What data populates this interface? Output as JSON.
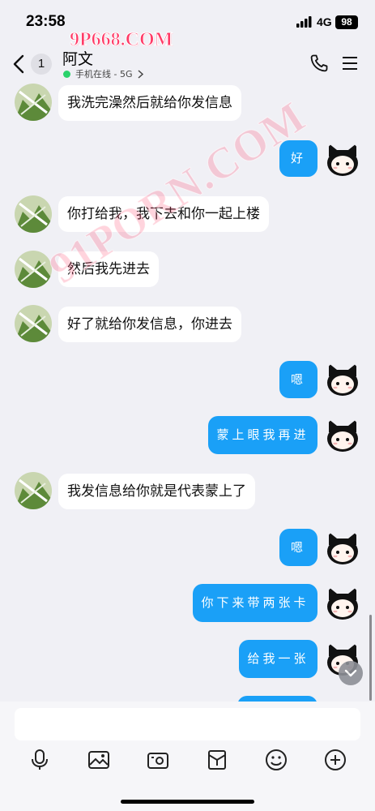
{
  "status_bar": {
    "time": "23:58",
    "network": "4G",
    "battery": "98"
  },
  "watermark": {
    "top": "9P668.COM",
    "diagonal": "91PORN.COM"
  },
  "header": {
    "unread_count": "1",
    "contact_name": "阿文",
    "online_status": "手机在线 - 5G"
  },
  "messages": [
    {
      "dir": "in",
      "text": "我洗完澡然后就给你发信息"
    },
    {
      "dir": "out",
      "text": "好"
    },
    {
      "dir": "in",
      "text": "你打给我，我下去和你一起上楼"
    },
    {
      "dir": "in",
      "text": "然后我先进去"
    },
    {
      "dir": "in",
      "text": "好了就给你发信息，你进去"
    },
    {
      "dir": "out",
      "text": "嗯"
    },
    {
      "dir": "out",
      "text": "蒙上眼我再进"
    },
    {
      "dir": "in",
      "text": "我发信息给你就是代表蒙上了"
    },
    {
      "dir": "out",
      "text": "嗯"
    },
    {
      "dir": "out",
      "text": "你下来带两张卡"
    },
    {
      "dir": "out",
      "text": "给我一张"
    }
  ],
  "input": {
    "placeholder": ""
  },
  "toolbar": [
    "microphone-icon",
    "image-icon",
    "camera-icon",
    "red-packet-icon",
    "emoji-icon",
    "plus-icon"
  ],
  "colors": {
    "outgoing_bubble": "#1aa0f7",
    "incoming_bubble": "#ffffff",
    "background": "#f0f0f5",
    "online_dot": "#2ad26b"
  }
}
